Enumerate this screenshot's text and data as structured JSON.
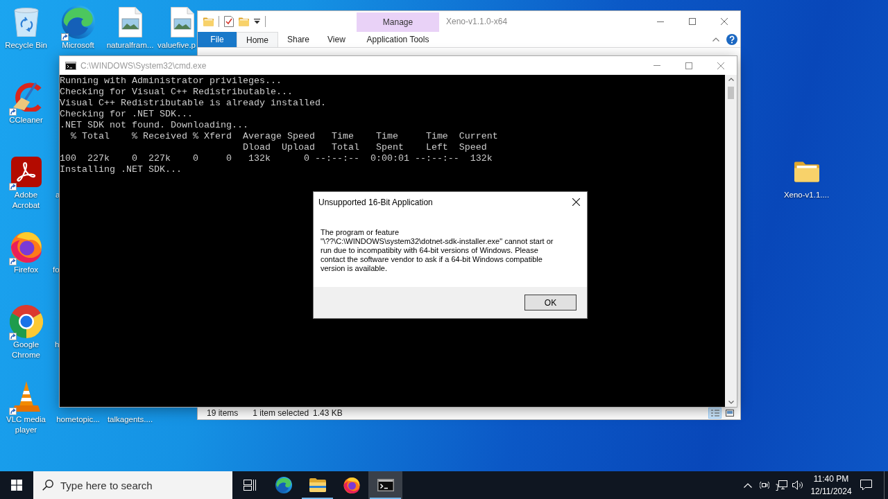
{
  "desktop": {
    "icons": [
      {
        "label": "Recycle Bin",
        "kind": "recycle-bin",
        "shortcut": false
      },
      {
        "label": "Microsoft",
        "kind": "edge",
        "shortcut": true
      },
      {
        "label": "naturalfram...",
        "kind": "image-file",
        "shortcut": false
      },
      {
        "label": "valuefive.p",
        "kind": "image-file",
        "shortcut": false
      },
      {
        "label": "CCleaner",
        "kind": "ccleaner",
        "shortcut": true
      },
      {
        "label": "Adobe Acrobat",
        "kind": "acrobat",
        "shortcut": true
      },
      {
        "label": "a",
        "kind": "covered"
      },
      {
        "label": "Firefox",
        "kind": "firefox",
        "shortcut": true
      },
      {
        "label": "fo",
        "kind": "covered"
      },
      {
        "label": "Google Chrome",
        "kind": "chrome",
        "shortcut": true
      },
      {
        "label": "h",
        "kind": "covered"
      },
      {
        "label": "VLC media player",
        "kind": "vlc",
        "shortcut": true
      },
      {
        "label": "hometopic...",
        "kind": "covered"
      },
      {
        "label": "talkagents....",
        "kind": "covered"
      },
      {
        "label": "Xeno-v1.1....",
        "kind": "folder",
        "shortcut": false
      }
    ]
  },
  "explorer": {
    "contextual_group": "Manage",
    "title": "Xeno-v1.1.0-x64",
    "tabs": [
      {
        "label": "File",
        "kind": "file",
        "selected": false
      },
      {
        "label": "Home",
        "kind": "tab",
        "selected": true
      },
      {
        "label": "Share",
        "kind": "tab",
        "selected": false
      },
      {
        "label": "View",
        "kind": "tab",
        "selected": false
      },
      {
        "label": "Application Tools",
        "kind": "contextual",
        "selected": false
      }
    ],
    "status_bar": {
      "item_count": "19 items",
      "selection": "1 item selected",
      "size": "1.43 KB"
    },
    "views": [
      {
        "kind": "details",
        "selected": true
      },
      {
        "kind": "large-icons",
        "selected": false
      }
    ]
  },
  "cmd": {
    "title": "C:\\WINDOWS\\System32\\cmd.exe",
    "lines": [
      "Running with Administrator privileges...",
      "Checking for Visual C++ Redistributable...",
      "Visual C++ Redistributable is already installed.",
      "Checking for .NET SDK...",
      ".NET SDK not found. Downloading...",
      "  % Total    % Received % Xferd  Average Speed   Time    Time     Time  Current",
      "                                 Dload  Upload   Total   Spent    Left  Speed",
      "100  227k    0  227k    0     0   132k      0 --:--:--  0:00:01 --:--:--  132k",
      "Installing .NET SDK..."
    ]
  },
  "dialog": {
    "title": "Unsupported 16-Bit Application",
    "message": "The program or feature \"\\??\\C:\\WINDOWS\\system32\\dotnet-sdk-installer.exe\" cannot start or run due to incompatibity with 64-bit versions of Windows. Please contact the software vendor to ask if a 64-bit Windows compatible version is available.",
    "buttons": [
      {
        "label": "OK",
        "default": true
      }
    ]
  },
  "taskbar": {
    "search": {
      "placeholder": "Type here to search"
    },
    "apps": [
      {
        "kind": "task-view",
        "running": false,
        "active": false
      },
      {
        "kind": "edge",
        "running": false,
        "active": false
      },
      {
        "kind": "explorer",
        "running": true,
        "active": false
      },
      {
        "kind": "firefox",
        "running": false,
        "active": false
      },
      {
        "kind": "cmd",
        "running": true,
        "active": true
      }
    ],
    "clock": {
      "time": "11:40 PM",
      "date": "12/11/2024"
    }
  }
}
